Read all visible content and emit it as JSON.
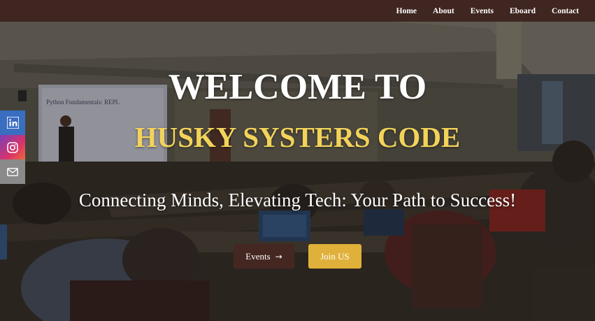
{
  "nav": {
    "items": [
      {
        "label": "Home"
      },
      {
        "label": "About"
      },
      {
        "label": "Events"
      },
      {
        "label": "Eboard"
      },
      {
        "label": "Contact"
      }
    ]
  },
  "hero": {
    "welcome": "WELCOME TO",
    "club_name": "HUSKY SYSTERS CODE",
    "tagline": "Connecting Minds, Elevating Tech: Your Path to Success!",
    "slide_title": "Python Fundamentals: REPL",
    "buttons": {
      "events_label": "Events",
      "events_arrow": "→",
      "join_label": "Join US"
    }
  },
  "social": [
    "linkedin-icon",
    "instagram-icon",
    "mail-icon"
  ],
  "colors": {
    "nav_bg": "#3f2620",
    "accent_gold": "#e0b13a",
    "title_gold": "#f2d35a",
    "events_btn": "#452722",
    "linkedin": "#3a6ec0",
    "mail": "#8a8a8a"
  }
}
